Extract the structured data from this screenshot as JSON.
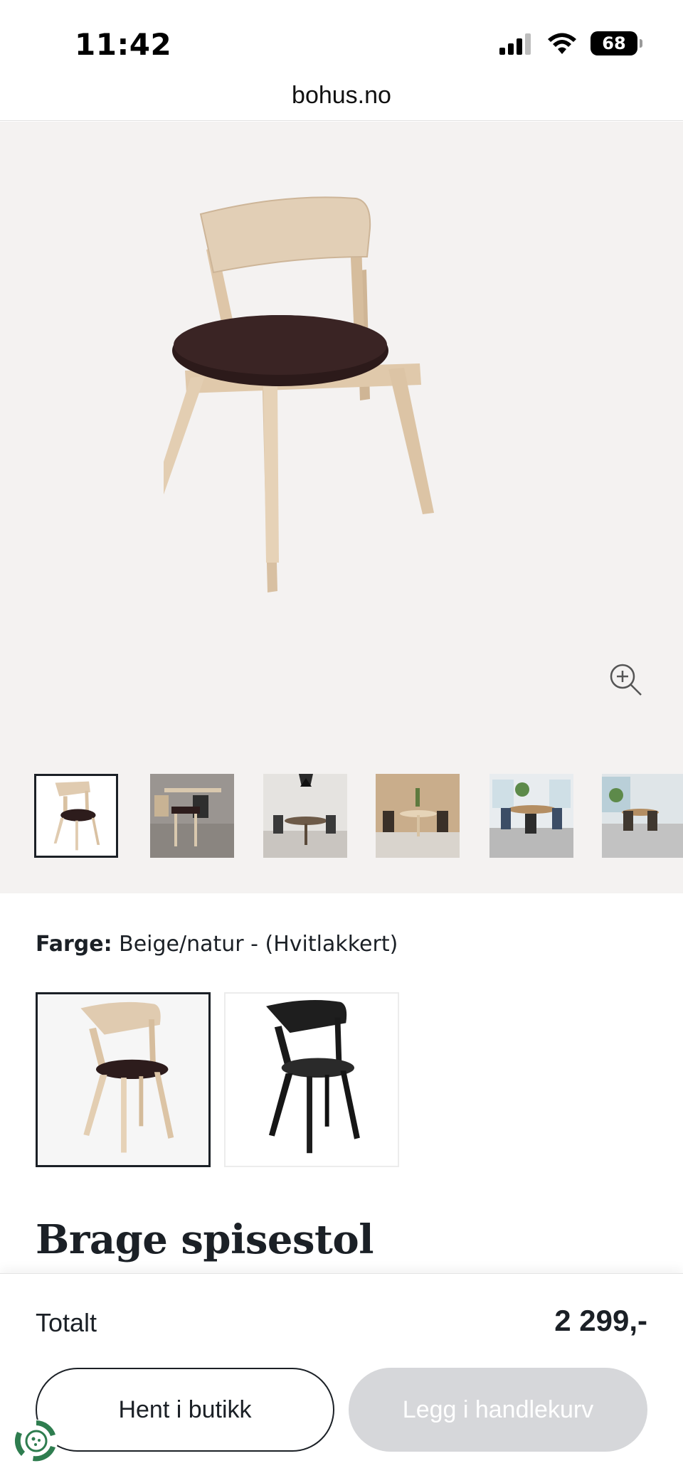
{
  "status_bar": {
    "time": "11:42",
    "battery": "68"
  },
  "browser": {
    "url": "bohus.no"
  },
  "gallery": {
    "zoom_icon": "zoom-in-icon",
    "thumbnail_count": 6,
    "active_thumbnail": 1
  },
  "color": {
    "label": "Farge:",
    "value": "Beige/natur - (Hvitlakkert)",
    "options": [
      "Beige/natur",
      "Svart"
    ]
  },
  "product": {
    "title": "Brage spisestol"
  },
  "checkout": {
    "total_label": "Totalt",
    "total_price": "2 299,-",
    "store_button": "Hent i butikk",
    "cart_button": "Legg i handlekurv"
  },
  "colors": {
    "text": "#1b2026",
    "gallery_bg": "#f4f2f1",
    "disabled_button": "#d6d7da",
    "eco_green": "#2e7d4f"
  }
}
